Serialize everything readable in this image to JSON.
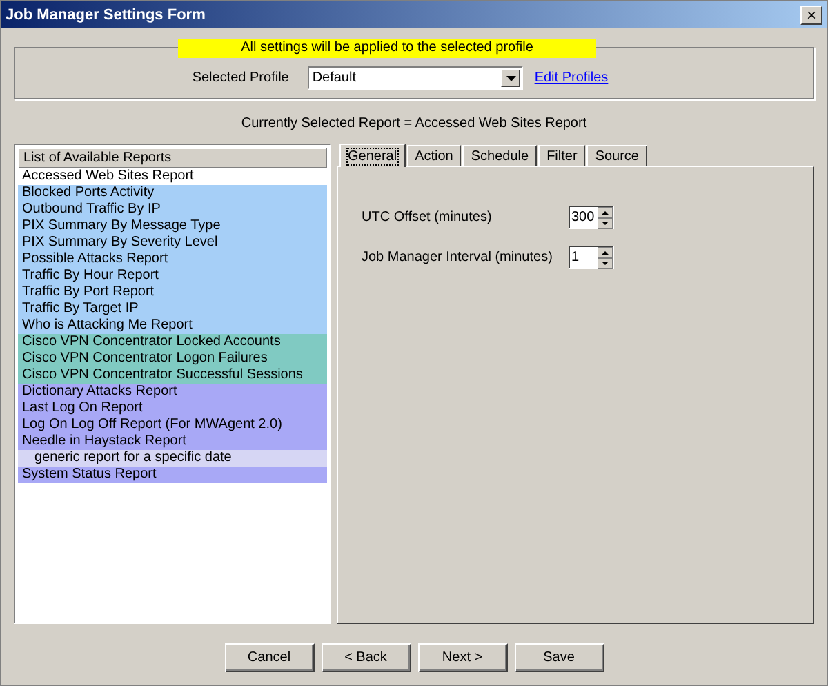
{
  "window": {
    "title": "Job Manager Settings Form",
    "close": "×"
  },
  "banner": "All settings will be applied to the selected profile",
  "profile": {
    "label": "Selected Profile",
    "value": "Default",
    "link": "Edit Profiles"
  },
  "current_report": "Currently Selected Report = Accessed Web Sites Report",
  "report_list": {
    "header": "List of Available Reports",
    "items": [
      {
        "label": "Accessed Web Sites Report",
        "color": "#ffffff"
      },
      {
        "label": "Blocked Ports Activity",
        "color": "#a6cff7"
      },
      {
        "label": "Outbound Traffic By IP",
        "color": "#a6cff7"
      },
      {
        "label": "PIX Summary By Message Type",
        "color": "#a6cff7"
      },
      {
        "label": "PIX Summary By Severity Level",
        "color": "#a6cff7"
      },
      {
        "label": "Possible Attacks Report",
        "color": "#a6cff7"
      },
      {
        "label": "Traffic By Hour Report",
        "color": "#a6cff7"
      },
      {
        "label": "Traffic By Port Report",
        "color": "#a6cff7"
      },
      {
        "label": "Traffic By Target IP",
        "color": "#a6cff7"
      },
      {
        "label": "Who is Attacking Me Report",
        "color": "#a6cff7"
      },
      {
        "label": "Cisco VPN Concentrator Locked Accounts",
        "color": "#80cac2"
      },
      {
        "label": "Cisco VPN Concentrator Logon Failures",
        "color": "#80cac2"
      },
      {
        "label": "Cisco VPN Concentrator Successful Sessions",
        "color": "#80cac2"
      },
      {
        "label": "Dictionary Attacks Report",
        "color": "#a8a8f6"
      },
      {
        "label": "Last Log On Report",
        "color": "#a8a8f6"
      },
      {
        "label": "Log On Log Off Report (For MWAgent 2.0)",
        "color": "#a8a8f6"
      },
      {
        "label": "Needle in Haystack Report",
        "color": "#a8a8f6",
        "children": [
          {
            "label": "generic report for a specific date",
            "color": "#d6d6f4"
          }
        ]
      },
      {
        "label": "System Status Report",
        "color": "#a8a8f6"
      }
    ]
  },
  "tabs": [
    {
      "label": "General",
      "selected": true
    },
    {
      "label": "Action",
      "selected": false
    },
    {
      "label": "Schedule",
      "selected": false
    },
    {
      "label": "Filter",
      "selected": false
    },
    {
      "label": "Source",
      "selected": false
    }
  ],
  "settings": [
    {
      "label": "UTC Offset (minutes)",
      "value": "300"
    },
    {
      "label": "Job Manager Interval (minutes)",
      "value": "1"
    }
  ],
  "buttons": [
    "Cancel",
    "< Back",
    "Next >",
    "Save"
  ]
}
